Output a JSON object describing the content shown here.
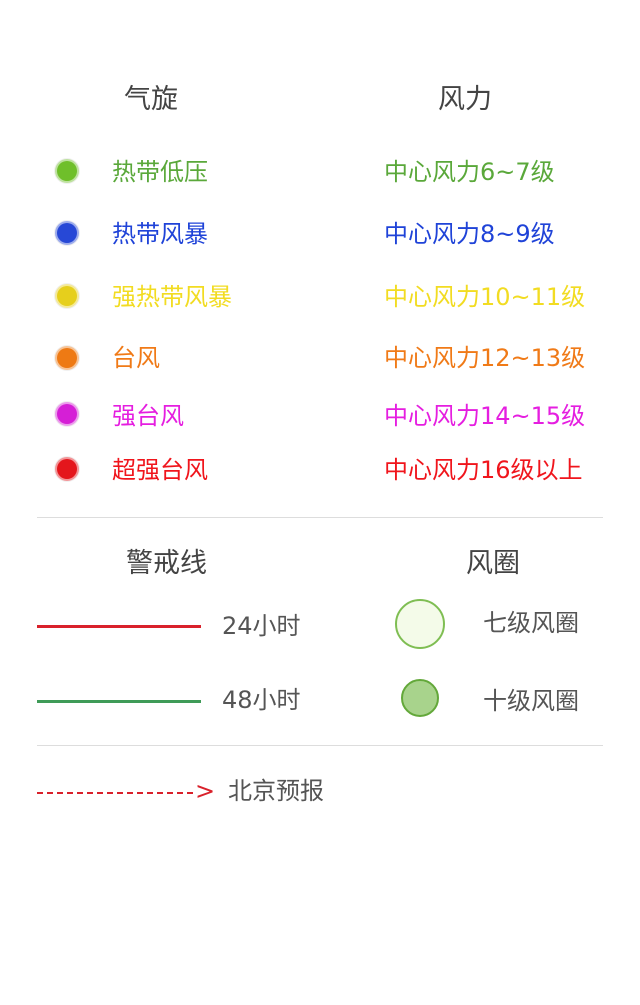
{
  "legend": {
    "cyclone_header": "气旋",
    "wind_header": "风力",
    "rows": [
      {
        "label": "热带低压",
        "wind": "中心风力6~7级",
        "color": "#5aa83a",
        "dot": "#6fbf2a"
      },
      {
        "label": "热带风暴",
        "wind": "中心风力8~9级",
        "color": "#1f43d8",
        "dot": "#2748d6"
      },
      {
        "label": "强热带风暴",
        "wind": "中心风力10~11级",
        "color": "#f2dc22",
        "dot": "#e6cf1c"
      },
      {
        "label": "台风",
        "wind": "中心风力12~13级",
        "color": "#f07a17",
        "dot": "#ee7a14"
      },
      {
        "label": "强台风",
        "wind": "中心风力14~15级",
        "color": "#e51ee0",
        "dot": "#d51fd6"
      },
      {
        "label": "超强台风",
        "wind": "中心风力16级以上",
        "color": "#f0151c",
        "dot": "#e4161c"
      }
    ]
  },
  "warning": {
    "header": "警戒线",
    "lines": [
      {
        "label": "24小时",
        "color": "#d9212b"
      },
      {
        "label": "48小时",
        "color": "#3f9b58"
      }
    ]
  },
  "wind_circle": {
    "header": "风圈",
    "items": [
      {
        "label": "七级风圈",
        "fill": "#f4fbe9",
        "stroke": "#7fbe53"
      },
      {
        "label": "十级风圈",
        "fill": "#a8d38c",
        "stroke": "#63a83a"
      }
    ]
  },
  "forecast": {
    "arrow": ">",
    "label": "北京预报",
    "color": "#d9212b"
  }
}
